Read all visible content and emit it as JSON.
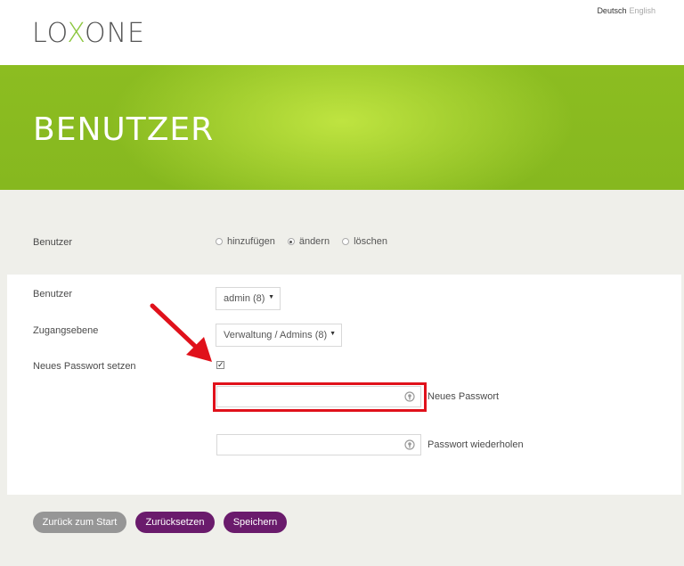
{
  "header": {
    "logo_left": "LO",
    "logo_x": "X",
    "logo_right": "ONE",
    "lang_active": "Deutsch",
    "lang_other": "English"
  },
  "banner": {
    "title": "BENUTZER"
  },
  "mode": {
    "label": "Benutzer",
    "options": [
      {
        "label": "hinzufügen",
        "checked": false
      },
      {
        "label": "ändern",
        "checked": true
      },
      {
        "label": "löschen",
        "checked": false
      }
    ]
  },
  "form": {
    "user_label": "Benutzer",
    "user_value": "admin (8)",
    "access_label": "Zugangsebene",
    "access_value": "Verwaltung / Admins (8)",
    "set_password_label": "Neues Passwort setzen",
    "set_password_checked": true,
    "new_password_label": "Neues Passwort",
    "repeat_password_label": "Passwort wiederholen"
  },
  "buttons": {
    "back": "Zurück zum Start",
    "reset": "Zurücksetzen",
    "save": "Speichern"
  },
  "colors": {
    "brand_green": "#8cbd21",
    "button_purple": "#6a1b6c",
    "highlight_red": "#e0111b"
  }
}
